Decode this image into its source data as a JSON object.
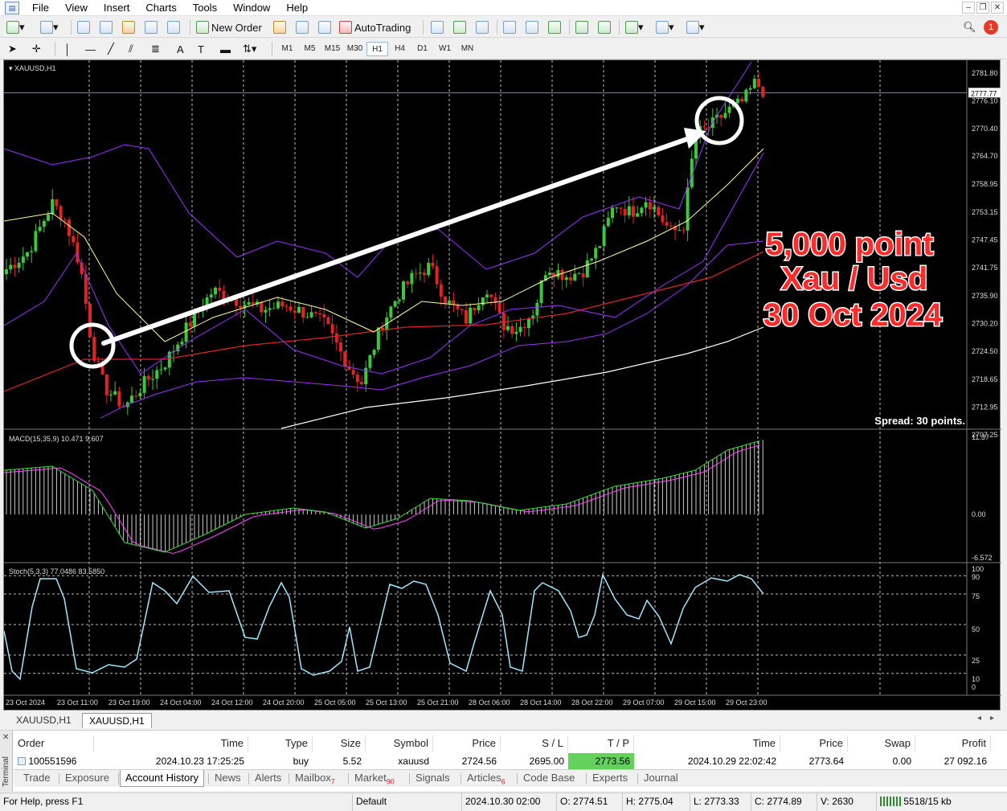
{
  "menu": [
    "File",
    "View",
    "Insert",
    "Charts",
    "Tools",
    "Window",
    "Help"
  ],
  "toolbar": {
    "new_order": "New Order",
    "autotrading": "AutoTrading"
  },
  "timeframes": [
    "M1",
    "M5",
    "M15",
    "M30",
    "H1",
    "H4",
    "D1",
    "W1",
    "MN"
  ],
  "active_timeframe": "H1",
  "chart": {
    "symbol_label": "XAUUSD,H1",
    "spread": "Spread: 30 points.",
    "price_current": "2777.77",
    "annotation": [
      "5,000 point",
      "Xau / Usd",
      "30 Oct 2024"
    ],
    "price_ticks": [
      "2781.80",
      "2776.10",
      "2770.40",
      "2764.70",
      "2758.95",
      "2753.15",
      "2747.45",
      "2741.75",
      "2735.90",
      "2730.20",
      "2724.50",
      "2718.65",
      "2712.95",
      "2707.25"
    ],
    "macd_label": "MACD(15,35,9) 10.471 9.607",
    "macd_ticks": [
      "11.37",
      "0.00",
      "-6.572"
    ],
    "stoch_label": "Stoch(5,3,3) 77.0486 83.5850",
    "stoch_ticks": [
      "100",
      "90",
      "75",
      "50",
      "25",
      "10",
      "0"
    ],
    "time_ticks": [
      "23 Oct 2024",
      "23 Oct 11:00",
      "23 Oct 19:00",
      "24 Oct 04:00",
      "24 Oct 12:00",
      "24 Oct 20:00",
      "25 Oct 05:00",
      "25 Oct 13:00",
      "25 Oct 21:00",
      "28 Oct 06:00",
      "28 Oct 14:00",
      "28 Oct 22:00",
      "29 Oct 07:00",
      "29 Oct 15:00",
      "29 Oct 23:00"
    ],
    "colors": {
      "bull": "#3cc83c",
      "bear": "#e02424",
      "bands": "#9b30ff",
      "ma_red": "#e02424",
      "ma_white": "#ffffff",
      "ma_yellow": "#ffff99",
      "macd_signal": "#ff44ff",
      "macd_main": "#33dd33",
      "stoch": "#9fe8ff"
    }
  },
  "chart_data": [
    {
      "type": "line",
      "title": "XAUUSD,H1",
      "series": [
        {
          "name": "XAUUSD",
          "x": [
            "23 Oct 2024",
            "23 Oct 11:00",
            "23 Oct 19:00",
            "24 Oct 04:00",
            "24 Oct 12:00",
            "24 Oct 20:00",
            "25 Oct 05:00",
            "25 Oct 13:00",
            "25 Oct 21:00",
            "28 Oct 06:00",
            "28 Oct 14:00",
            "28 Oct 22:00",
            "29 Oct 07:00",
            "29 Oct 15:00",
            "29 Oct 23:00"
          ],
          "values": [
            2741,
            2733,
            2716,
            2726,
            2735,
            2734,
            2731,
            2722,
            2744,
            2733,
            2740,
            2745,
            2754,
            2749,
            2776
          ]
        }
      ],
      "ylim": [
        2707.25,
        2781.8
      ],
      "grid": true
    },
    {
      "type": "line",
      "title": "MACD(15,35,9) 10.471 9.607",
      "series": [
        {
          "name": "MACD",
          "values": [
            9.5,
            7.4,
            -6.0,
            -3.6,
            0.2,
            0.8,
            -1.0,
            -3.4,
            1.3,
            0.8,
            0.3,
            1.0,
            3.2,
            4.4,
            10.471
          ]
        }
      ],
      "ylim": [
        -6.572,
        11.37
      ]
    },
    {
      "type": "line",
      "title": "Stoch(5,3,3) 77.0486 83.5850",
      "series": [
        {
          "name": "Stoch",
          "values": [
            50,
            85,
            20,
            85,
            60,
            85,
            15,
            90,
            45,
            90,
            20,
            80,
            40,
            90,
            77.0486
          ]
        }
      ],
      "ylim": [
        0,
        100
      ]
    }
  ],
  "chart_tabs": [
    "XAUUSD,H1",
    "XAUUSD,H1"
  ],
  "terminal": {
    "headers": [
      "Order",
      "Time",
      "Type",
      "Size",
      "Symbol",
      "Price",
      "S / L",
      "T / P",
      "Time",
      "Price",
      "Swap",
      "Profit"
    ],
    "row": [
      "100551596",
      "2024.10.23 17:25:25",
      "buy",
      "5.52",
      "xauusd",
      "2724.56",
      "2695.00",
      "2773.56",
      "2024.10.29 22:02:42",
      "2773.64",
      "0.00",
      "27 092.16"
    ],
    "side_label": "Terminal",
    "tabs": [
      {
        "label": "Trade",
        "badge": ""
      },
      {
        "label": "Exposure",
        "badge": ""
      },
      {
        "label": "Account History",
        "badge": ""
      },
      {
        "label": "News",
        "badge": ""
      },
      {
        "label": "Alerts",
        "badge": ""
      },
      {
        "label": "Mailbox",
        "badge": "7"
      },
      {
        "label": "Market",
        "badge": "90"
      },
      {
        "label": "Signals",
        "badge": ""
      },
      {
        "label": "Articles",
        "badge": "6"
      },
      {
        "label": "Code Base",
        "badge": ""
      },
      {
        "label": "Experts",
        "badge": ""
      },
      {
        "label": "Journal",
        "badge": ""
      }
    ]
  },
  "status": {
    "help": "For Help, press F1",
    "profile": "Default",
    "datetime": "2024.10.30 02:00",
    "open": "O: 2774.51",
    "high": "H: 2775.04",
    "low": "L: 2773.33",
    "close": "C: 2774.89",
    "volume": "V: 2630",
    "traffic": "5518/15 kb"
  }
}
